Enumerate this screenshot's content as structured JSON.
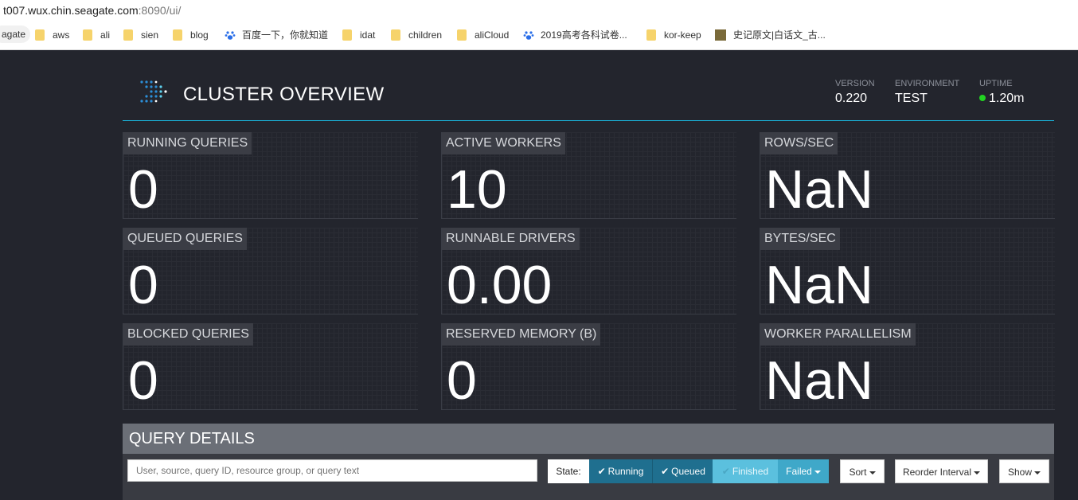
{
  "browser": {
    "url_host": "t007.wux.chin.seagate.com",
    "url_path": ":8090/ui/",
    "bookmarks": [
      {
        "label": "agate",
        "icon": "tab-chip"
      },
      {
        "label": "aws",
        "icon": "folder-icon"
      },
      {
        "label": "ali",
        "icon": "folder-icon"
      },
      {
        "label": "sien",
        "icon": "folder-icon"
      },
      {
        "label": "blog",
        "icon": "folder-icon"
      },
      {
        "label": "百度一下，你就知道",
        "icon": "baidu-paw-icon"
      },
      {
        "label": "idat",
        "icon": "folder-icon"
      },
      {
        "label": "children",
        "icon": "folder-icon"
      },
      {
        "label": "aliCloud",
        "icon": "folder-icon"
      },
      {
        "label": "2019高考各科试卷...",
        "icon": "baidu-paw-icon"
      },
      {
        "label": "kor-keep",
        "icon": "folder-icon"
      },
      {
        "label": "史记原文|白话文_古...",
        "icon": "site-favicon"
      }
    ]
  },
  "header": {
    "title": "CLUSTER OVERVIEW",
    "version_label": "VERSION",
    "version_value": "0.220",
    "environment_label": "ENVIRONMENT",
    "environment_value": "TEST",
    "uptime_label": "UPTIME",
    "uptime_value": "1.20m",
    "uptime_status_color": "#22d322",
    "accent_color": "#1ab1d8"
  },
  "stats": {
    "running_queries": {
      "label": "RUNNING QUERIES",
      "value": "0"
    },
    "active_workers": {
      "label": "ACTIVE WORKERS",
      "value": "10"
    },
    "rows_sec": {
      "label": "ROWS/SEC",
      "value": "NaN"
    },
    "queued_queries": {
      "label": "QUEUED QUERIES",
      "value": "0"
    },
    "runnable_drivers": {
      "label": "RUNNABLE DRIVERS",
      "value": "0.00"
    },
    "bytes_sec": {
      "label": "BYTES/SEC",
      "value": "NaN"
    },
    "blocked_queries": {
      "label": "BLOCKED QUERIES",
      "value": "0"
    },
    "reserved_memory": {
      "label": "RESERVED MEMORY (B)",
      "value": "0"
    },
    "worker_parallelism": {
      "label": "WORKER PARALLELISM",
      "value": "NaN"
    }
  },
  "query_details": {
    "title": "QUERY DETAILS",
    "search_placeholder": "User, source, query ID, resource group, or query text",
    "state_label": "State:",
    "filters": {
      "running": "Running",
      "queued": "Queued",
      "finished": "Finished",
      "failed": "Failed"
    },
    "sort_label": "Sort",
    "reorder_label": "Reorder Interval",
    "show_label": "Show"
  }
}
